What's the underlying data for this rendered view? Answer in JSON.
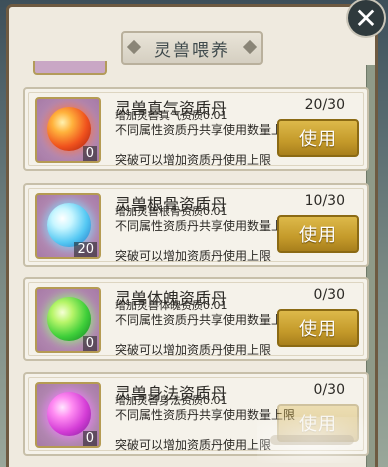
{
  "header": {
    "title": "灵兽喂养",
    "close_icon": "close-icon"
  },
  "items": [
    {
      "name": "灵兽真气资质丹",
      "effect": "增加灵兽真气资质0.01",
      "shared": "不同属性资质丹共享使用数量上限",
      "breakthrough": "突破可以增加资质丹使用上限",
      "progress": "20/30",
      "count": "0",
      "button": "使用",
      "orb_color": "red"
    },
    {
      "name": "灵兽根骨资质丹",
      "effect": "增加灵兽根骨资质0.01",
      "shared": "不同属性资质丹共享使用数量上限",
      "breakthrough": "突破可以增加资质丹使用上限",
      "progress": "10/30",
      "count": "20",
      "button": "使用",
      "orb_color": "cyan"
    },
    {
      "name": "灵兽体魄资质丹",
      "effect": "增加灵兽体魄资质0.01",
      "shared": "不同属性资质丹共享使用数量上限",
      "breakthrough": "突破可以增加资质丹使用上限",
      "progress": "0/30",
      "count": "0",
      "button": "使用",
      "orb_color": "green"
    },
    {
      "name": "灵兽身法资质丹",
      "effect": "增加灵兽身法资质0.01",
      "shared": "不同属性资质丹共享使用数量上限",
      "breakthrough": "突破可以增加资质丹使用上限",
      "progress": "0/30",
      "count": "0",
      "button": "使用",
      "orb_color": "purple"
    }
  ]
}
